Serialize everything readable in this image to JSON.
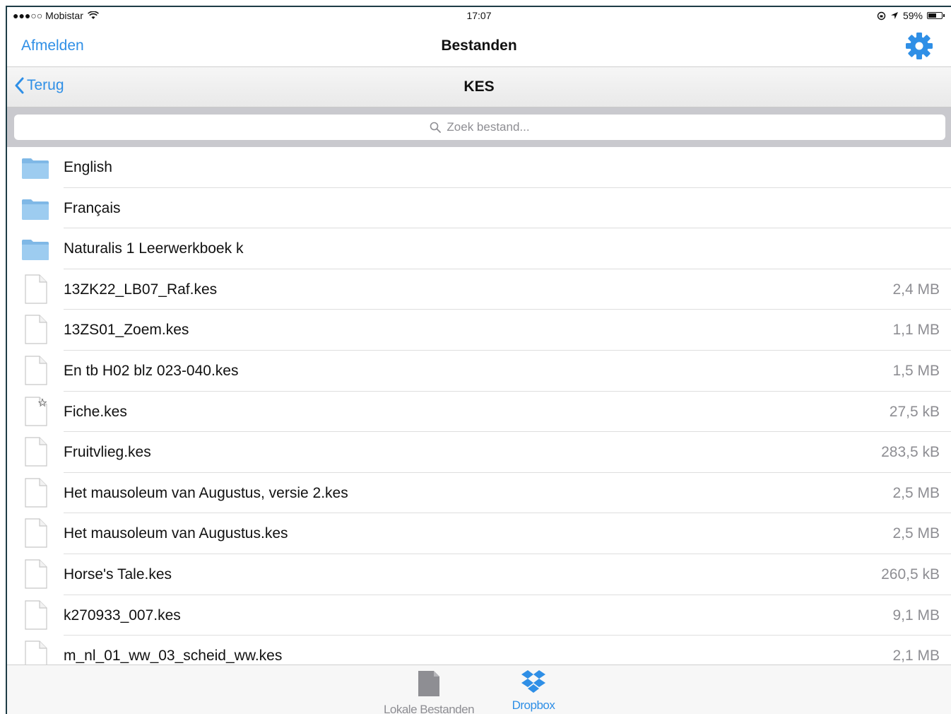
{
  "status_bar": {
    "carrier": "●●●○○ Mobistar",
    "time": "17:07",
    "battery": "59%",
    "battery_level": 0.59
  },
  "navbar": {
    "left_button": "Afmelden",
    "title": "Bestanden",
    "right_icon": "gear-icon"
  },
  "subbar": {
    "back_label": "Terug",
    "title": "KES"
  },
  "search": {
    "placeholder": "Zoek bestand..."
  },
  "files": [
    {
      "name": "English",
      "size": "",
      "type": "folder"
    },
    {
      "name": "Français",
      "size": "",
      "type": "folder"
    },
    {
      "name": "Naturalis 1 Leerwerkboek k",
      "size": "",
      "type": "folder"
    },
    {
      "name": "13ZK22_LB07_Raf.kes",
      "size": "2,4 MB",
      "type": "file"
    },
    {
      "name": "13ZS01_Zoem.kes",
      "size": "1,1 MB",
      "type": "file"
    },
    {
      "name": "En tb H02 blz 023-040.kes",
      "size": "1,5 MB",
      "type": "file"
    },
    {
      "name": "Fiche.kes",
      "size": "27,5 kB",
      "type": "file-starred"
    },
    {
      "name": "Fruitvlieg.kes",
      "size": "283,5 kB",
      "type": "file"
    },
    {
      "name": "Het mausoleum van Augustus, versie 2.kes",
      "size": "2,5 MB",
      "type": "file"
    },
    {
      "name": "Het mausoleum van Augustus.kes",
      "size": "2,5 MB",
      "type": "file"
    },
    {
      "name": "Horse's Tale.kes",
      "size": "260,5 kB",
      "type": "file"
    },
    {
      "name": "k270933_007.kes",
      "size": "9,1 MB",
      "type": "file"
    },
    {
      "name": "m_nl_01_ww_03_scheid_ww.kes",
      "size": "2,1 MB",
      "type": "file"
    }
  ],
  "tabs": [
    {
      "label": "Lokale Bestanden",
      "icon": "document-icon",
      "active": false
    },
    {
      "label": "Dropbox",
      "icon": "dropbox-icon",
      "active": true
    }
  ],
  "colors": {
    "accent": "#2f8fe6",
    "folder": "#7fb8e6",
    "secondary_text": "#8e8e93"
  }
}
